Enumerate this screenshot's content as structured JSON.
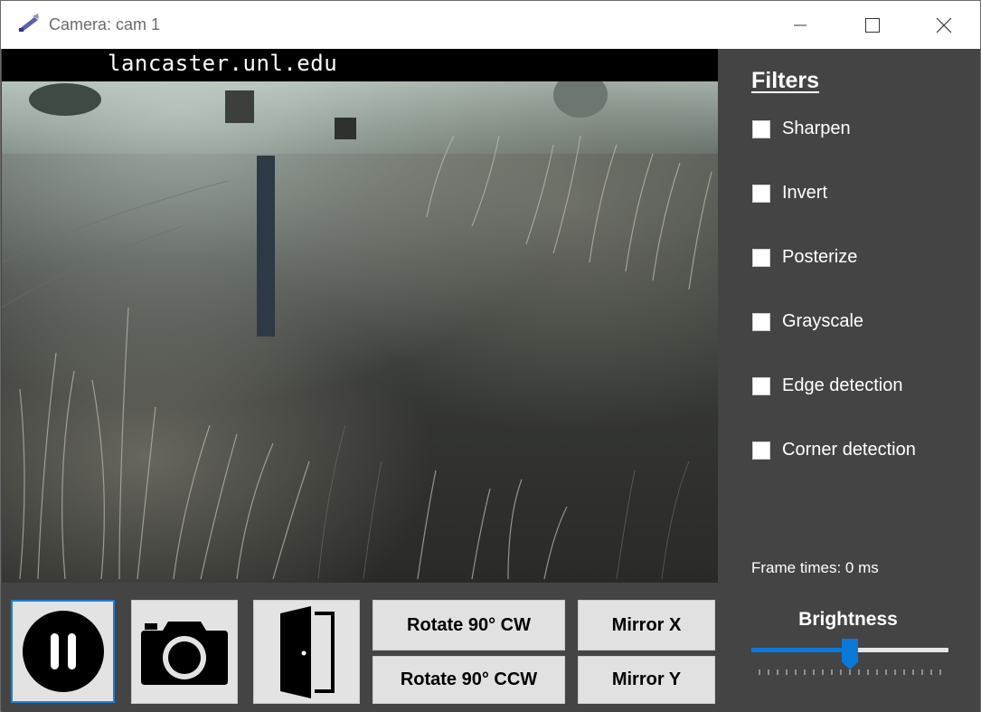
{
  "window": {
    "title": "Camera: cam 1",
    "icon": "camera-app-icon",
    "controls": [
      "minimize-icon",
      "maximize-icon",
      "close-icon"
    ]
  },
  "video": {
    "overlay_text": "lancaster.unl.edu"
  },
  "filters": {
    "title": "Filters",
    "items": [
      {
        "label": "Sharpen",
        "checked": false
      },
      {
        "label": "Invert",
        "checked": false
      },
      {
        "label": "Posterize",
        "checked": false
      },
      {
        "label": "Grayscale",
        "checked": false
      },
      {
        "label": "Edge detection",
        "checked": false
      },
      {
        "label": "Corner detection",
        "checked": false
      }
    ]
  },
  "status": {
    "frame_times": "Frame times: 0 ms"
  },
  "brightness": {
    "label": "Brightness",
    "value_fraction": 0.5,
    "tick_count": 21
  },
  "controls": {
    "pause_icon": "pause-icon",
    "snapshot_icon": "camera-icon",
    "exit_icon": "door-exit-icon",
    "rotate_cw": "Rotate 90° CW",
    "rotate_ccw": "Rotate 90° CCW",
    "mirror_x": "Mirror X",
    "mirror_y": "Mirror Y"
  },
  "colors": {
    "panel_bg": "#444444",
    "accent": "#0a7ad8",
    "button_bg": "#e1e1e1"
  }
}
